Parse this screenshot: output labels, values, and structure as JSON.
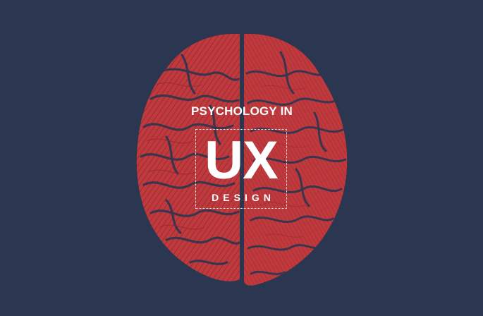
{
  "colors": {
    "background": "#2b3651",
    "brain": "#c0393c",
    "brain_dark": "#8f2a33",
    "text": "#ffffff"
  },
  "illustration": {
    "subject": "brain-top-view-engraving"
  },
  "title": {
    "line1": "PSYCHOLOGY IN",
    "main": "UX",
    "line3": "DESIGN"
  }
}
